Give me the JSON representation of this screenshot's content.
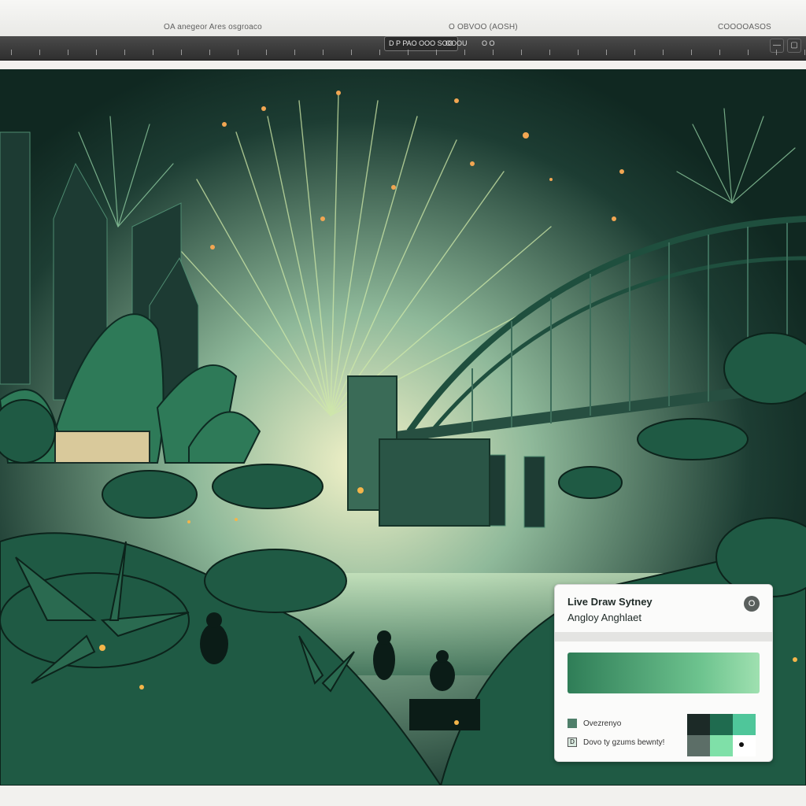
{
  "titlebar": {
    "left_text": "OA anegeor   Ares   osgroaco",
    "center_text": "O   OBVOO (AOSH)",
    "right_text": "COOOOASOS"
  },
  "toolbar": {
    "pill_label": "D P PAO OOO SOO",
    "item_label": "OOOU",
    "item2_label": "O   O"
  },
  "window": {
    "min_label": "—",
    "max_label": "▢"
  },
  "card": {
    "title": "Live Draw Sytney",
    "subtitle": "Angloy Anghlaet",
    "close_label": "O",
    "row1_label": "Ovezrenyo",
    "row2_check": "D",
    "row2_label": "Dovo ty gzums bewnty!"
  },
  "colors": {
    "accent": "#2f7d57",
    "palette": [
      "#1c2a27",
      "#1f6b4f",
      "#4fc69a",
      "#5c6e67",
      "#7fe0a8",
      "#ffffff"
    ]
  },
  "icons": {
    "close": "close-icon",
    "swatch": "color-swatch-icon",
    "checkbox": "checkbox-icon"
  }
}
